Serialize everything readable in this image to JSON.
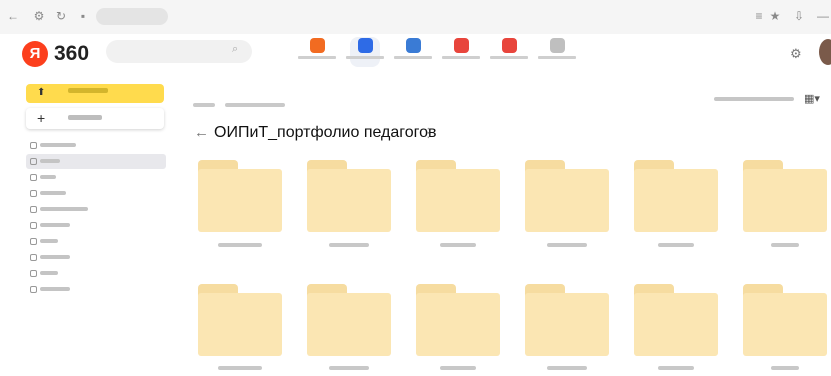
{
  "app": {
    "logo_mark": "Я",
    "logo_text": "360",
    "accent": "#fc3f1d",
    "brand_yellow": "#ffdb4d",
    "folder_color": "#fbe6b3"
  },
  "browser": {
    "icons": [
      "back-arrow-icon",
      "extensions-icon",
      "reload-icon",
      "lock-icon"
    ],
    "right_icons": [
      "menu-icon",
      "bookmark-icon",
      "download-icon",
      "minimize-icon"
    ]
  },
  "header": {
    "services": [
      {
        "name": "mail",
        "color": "#f26b21",
        "active": false
      },
      {
        "name": "disk",
        "color": "#2e6be6",
        "active": true
      },
      {
        "name": "documents",
        "color": "#3a7bd5",
        "active": false
      },
      {
        "name": "calendar",
        "color": "#e8453c",
        "active": false
      },
      {
        "name": "telemost",
        "color": "#e8453c",
        "active": false
      },
      {
        "name": "more",
        "color": "#bfbfbf",
        "active": false
      }
    ]
  },
  "sidebar": {
    "items": [
      {
        "key": "recent",
        "width": 36,
        "active": false
      },
      {
        "key": "files",
        "width": 20,
        "active": true
      },
      {
        "key": "photo",
        "width": 16,
        "active": false
      },
      {
        "key": "albums",
        "width": 26,
        "active": false
      },
      {
        "key": "shared",
        "width": 48,
        "active": false
      },
      {
        "key": "history",
        "width": 30,
        "active": false
      },
      {
        "key": "archive",
        "width": 18,
        "active": false
      },
      {
        "key": "downloads",
        "width": 30,
        "active": false
      },
      {
        "key": "scans",
        "width": 18,
        "active": false
      },
      {
        "key": "trash",
        "width": 30,
        "active": false
      }
    ]
  },
  "main": {
    "folder_title": "ОИПиТ_портфолио педагогов",
    "folders": [
      {
        "row": 0
      },
      {
        "row": 0
      },
      {
        "row": 0
      },
      {
        "row": 0
      },
      {
        "row": 0
      },
      {
        "row": 0
      },
      {
        "row": 1
      },
      {
        "row": 1
      },
      {
        "row": 1
      },
      {
        "row": 1
      },
      {
        "row": 1
      },
      {
        "row": 1
      }
    ]
  }
}
